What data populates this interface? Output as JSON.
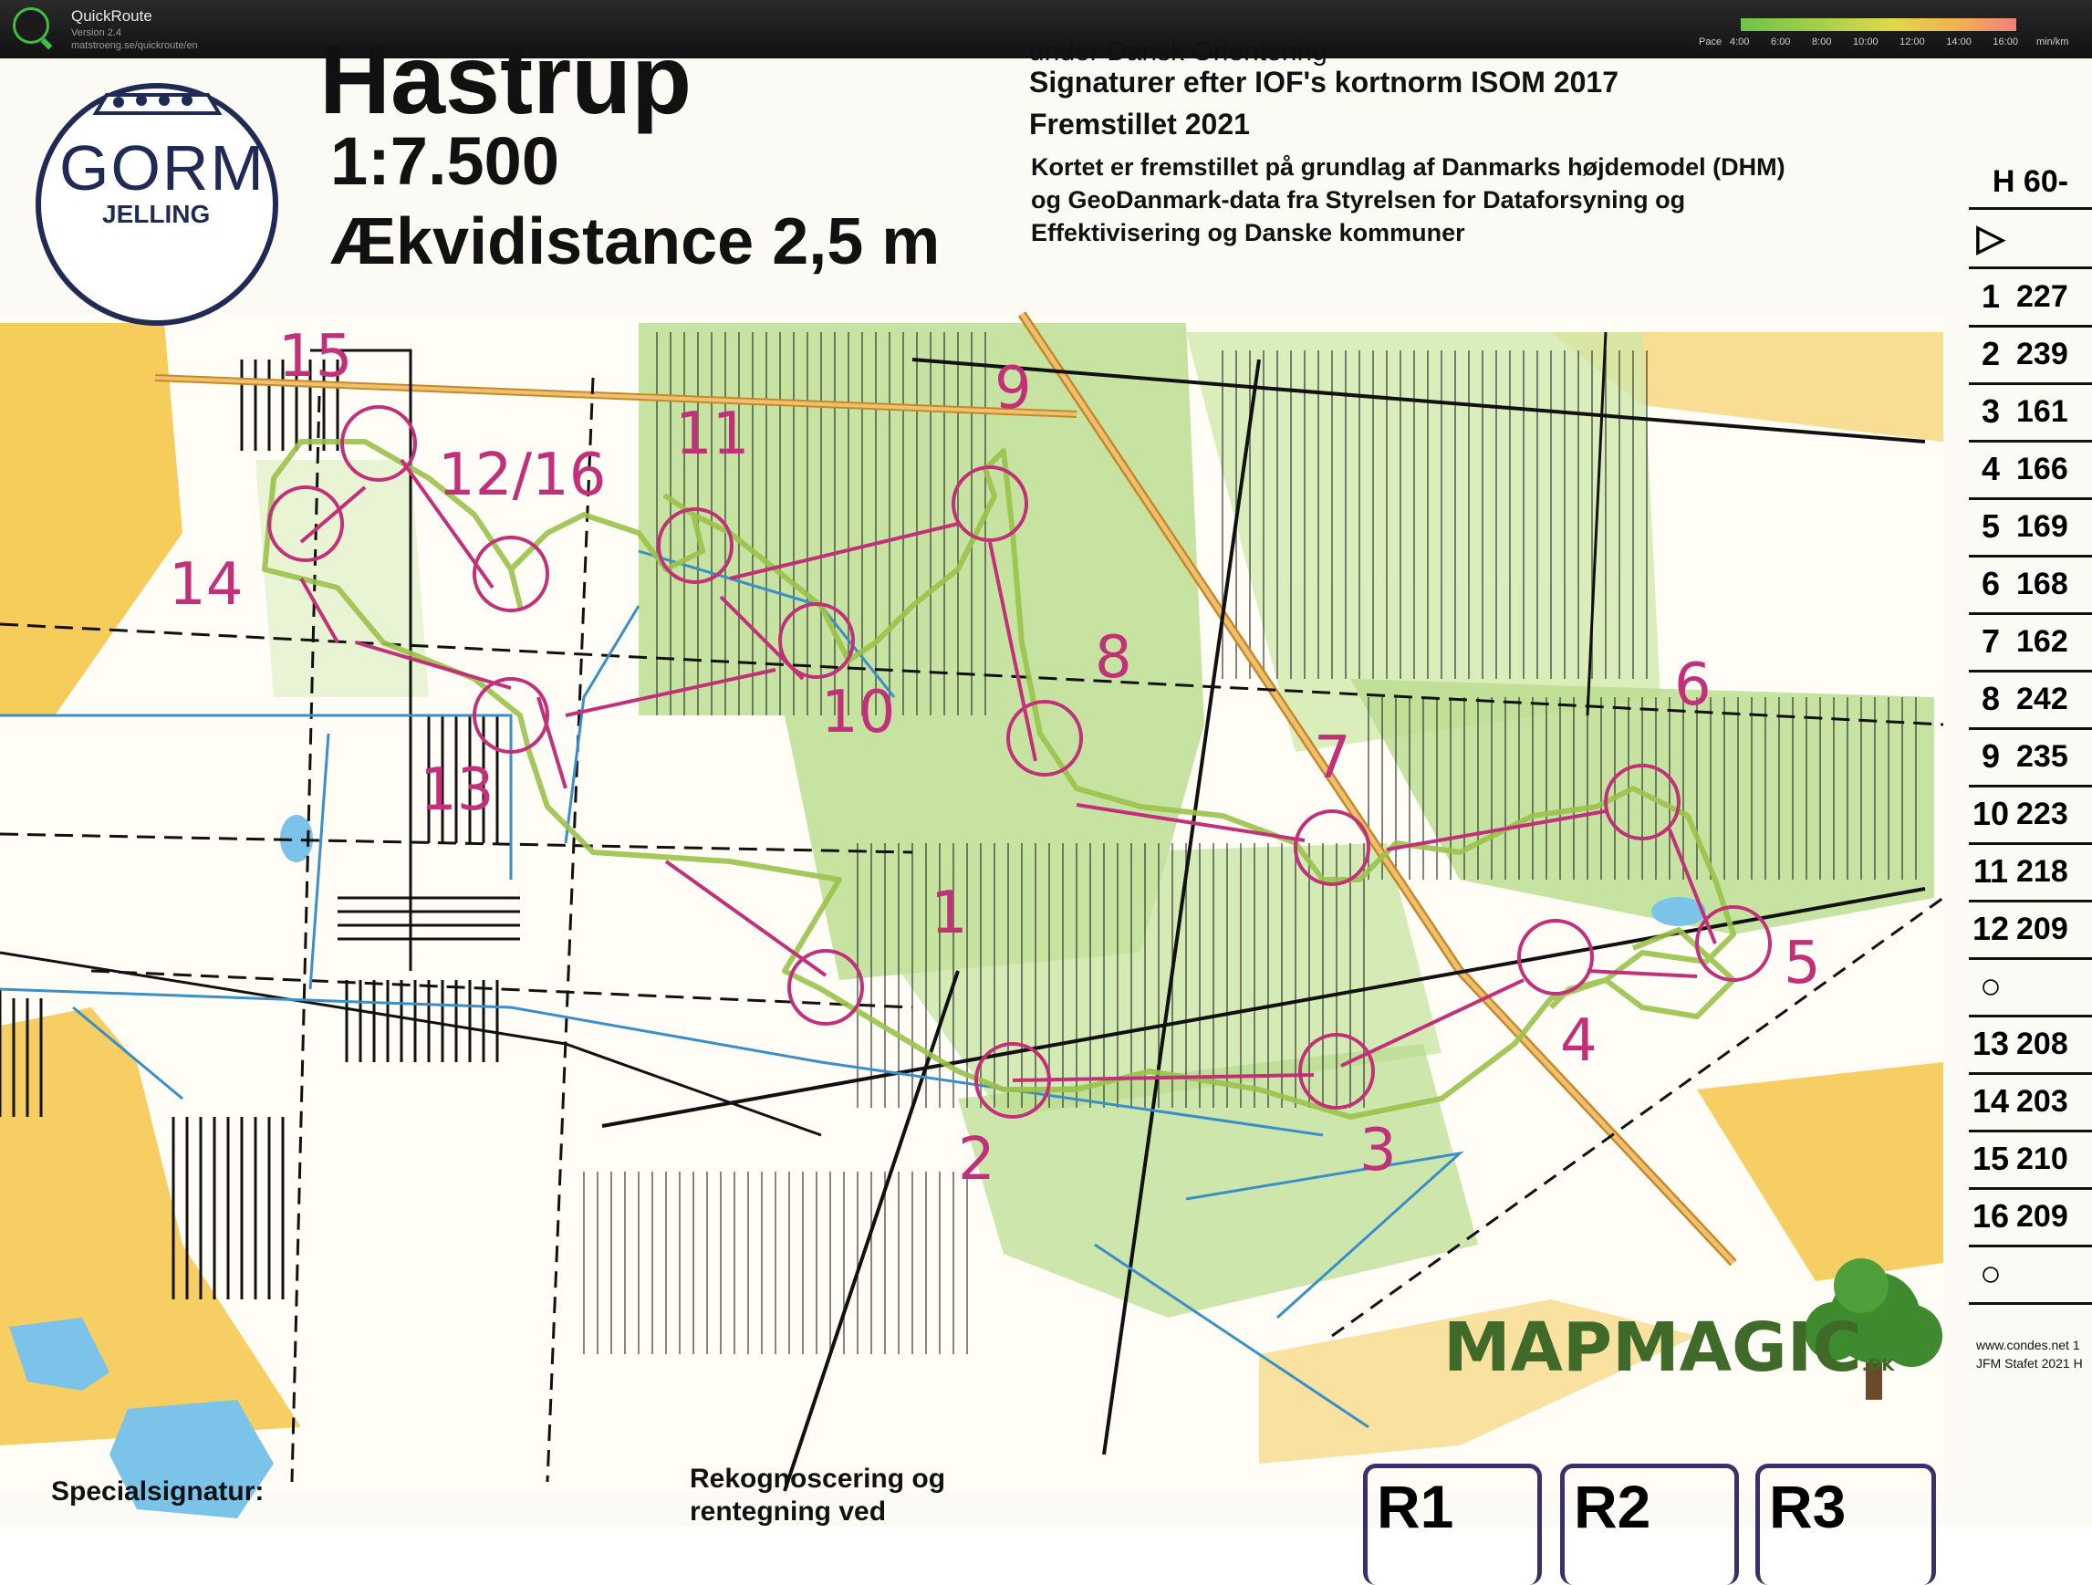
{
  "app": {
    "name": "QuickRoute",
    "version": "Version 2.4",
    "url": "matstroeng.se/quickroute/en"
  },
  "pace_legend": {
    "label": "Pace",
    "ticks": [
      "4:00",
      "6:00",
      "8:00",
      "10:00",
      "12:00",
      "14:00",
      "16:00"
    ],
    "unit": "min/km",
    "colors": [
      "#6fc24a",
      "#a8d04a",
      "#e0d84a",
      "#f0b050",
      "#f08080"
    ]
  },
  "map": {
    "title_partial": "Hastrup",
    "scale": "1:7.500",
    "contour": "Ækvidistance 2,5 m",
    "logo_name": "GORM",
    "logo_town": "JELLING",
    "info_lines": [
      "under Dansk Orientering",
      "Signaturer efter IOF's kortnorm ISOM 2017",
      "Fremstillet 2021",
      "Kortet er fremstillet på grundlag af Danmarks højdemodel (DHM)",
      "og GeoDanmark-data fra Styrelsen for Dataforsyning og",
      "Effektivisering og Danske kommuner"
    ],
    "special_symbols": "Specialsignatur:",
    "recon_line1": "Rekognoscering og",
    "recon_line2": "rentegning ved",
    "mapmagic": "MAPMAGIC",
    "mapmagic_suffix": ".DK",
    "condes": "www.condes.net 1",
    "event": "JFM Stafet 2021 H",
    "relay_boxes": [
      "R1",
      "R2",
      "R3"
    ],
    "controls": [
      {
        "num": "1"
      },
      {
        "num": "2"
      },
      {
        "num": "3"
      },
      {
        "num": "4"
      },
      {
        "num": "5"
      },
      {
        "num": "6"
      },
      {
        "num": "7"
      },
      {
        "num": "8"
      },
      {
        "num": "9"
      },
      {
        "num": "10"
      },
      {
        "num": "11"
      },
      {
        "num": "12/16"
      },
      {
        "num": "13"
      },
      {
        "num": "14"
      },
      {
        "num": "15"
      }
    ]
  },
  "description": {
    "class": "H 60-",
    "rows": [
      {
        "n": "1",
        "code": "227"
      },
      {
        "n": "2",
        "code": "239"
      },
      {
        "n": "3",
        "code": "161"
      },
      {
        "n": "4",
        "code": "166"
      },
      {
        "n": "5",
        "code": "169"
      },
      {
        "n": "6",
        "code": "168"
      },
      {
        "n": "7",
        "code": "162"
      },
      {
        "n": "8",
        "code": "242"
      },
      {
        "n": "9",
        "code": "235"
      },
      {
        "n": "10",
        "code": "223"
      },
      {
        "n": "11",
        "code": "218"
      },
      {
        "n": "12",
        "code": "209"
      },
      {
        "n": "13",
        "code": "208"
      },
      {
        "n": "14",
        "code": "203"
      },
      {
        "n": "15",
        "code": "210"
      },
      {
        "n": "16",
        "code": "209"
      }
    ]
  },
  "colors": {
    "course": "#c2307a",
    "route": "#9ac24a",
    "forest": "#b8dc8c",
    "open": "#f5c64a",
    "water": "#3a8fc8"
  }
}
